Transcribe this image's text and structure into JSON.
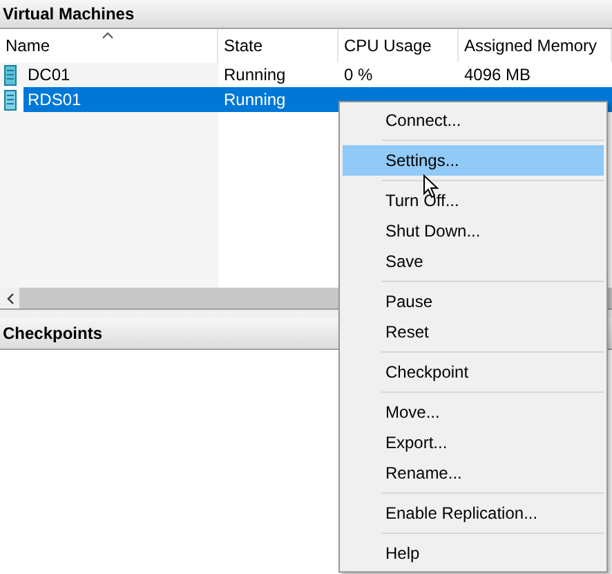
{
  "vm_panel": {
    "title": "Virtual Machines",
    "columns": [
      {
        "label": "Name",
        "sorted": true
      },
      {
        "label": "State",
        "sorted": false
      },
      {
        "label": "CPU Usage",
        "sorted": false
      },
      {
        "label": "Assigned Memory",
        "sorted": false
      }
    ],
    "rows": [
      {
        "cells": [
          "DC01",
          "Running",
          "0 %",
          "4096 MB"
        ],
        "selected": false
      },
      {
        "cells": [
          "RDS01",
          "Running"
        ],
        "selected": true
      }
    ]
  },
  "checkpoints_panel": {
    "title": "Checkpoints"
  },
  "context_menu": [
    {
      "kind": "item",
      "label": "Connect...",
      "selected": false
    },
    {
      "kind": "separator"
    },
    {
      "kind": "item",
      "label": "Settings...",
      "selected": true
    },
    {
      "kind": "separator"
    },
    {
      "kind": "item",
      "label": "Turn Off...",
      "selected": false
    },
    {
      "kind": "item",
      "label": "Shut Down...",
      "selected": false
    },
    {
      "kind": "item",
      "label": "Save",
      "selected": false
    },
    {
      "kind": "separator"
    },
    {
      "kind": "item",
      "label": "Pause",
      "selected": false
    },
    {
      "kind": "item",
      "label": "Reset",
      "selected": false
    },
    {
      "kind": "separator"
    },
    {
      "kind": "item",
      "label": "Checkpoint",
      "selected": false
    },
    {
      "kind": "separator"
    },
    {
      "kind": "item",
      "label": "Move...",
      "selected": false
    },
    {
      "kind": "item",
      "label": "Export...",
      "selected": false
    },
    {
      "kind": "item",
      "label": "Rename...",
      "selected": false
    },
    {
      "kind": "separator"
    },
    {
      "kind": "item",
      "label": "Enable Replication...",
      "selected": false
    },
    {
      "kind": "separator"
    },
    {
      "kind": "item",
      "label": "Help",
      "selected": false
    }
  ]
}
